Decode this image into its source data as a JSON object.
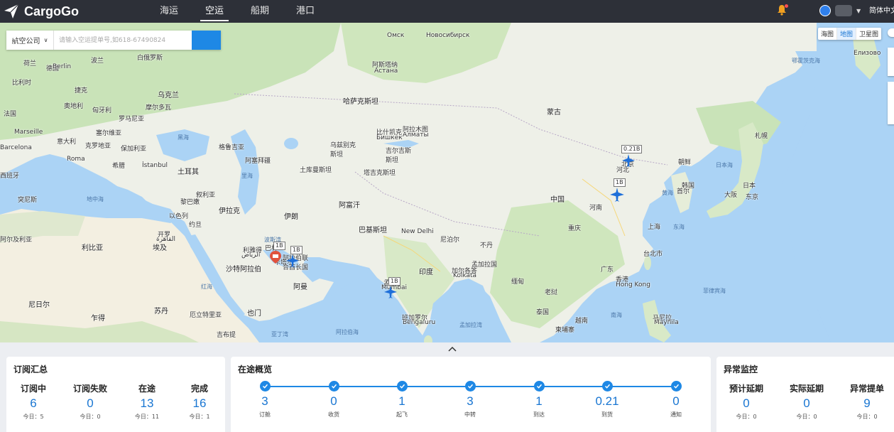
{
  "app": {
    "name": "CargoGo",
    "language": "简体中文"
  },
  "nav": {
    "items": [
      "海运",
      "空运",
      "船期",
      "港口"
    ],
    "active": "空运"
  },
  "search": {
    "select_label": "航空公司",
    "placeholder": "请输入空运提单号,如618-67490824"
  },
  "map_types": [
    "海图",
    "地图",
    "卫星图"
  ],
  "map_type_active": "地图",
  "map_labels": {
    "countries": [
      "蒙古",
      "中国",
      "印度",
      "伊朗",
      "阿富汗",
      "巴基斯坦",
      "哈萨克斯坦",
      "乌兹别克斯坦",
      "土库曼斯坦",
      "吉尔吉斯斯坦",
      "塔吉克斯坦",
      "土耳其",
      "伊拉克",
      "叙利亚",
      "约旦",
      "以色列",
      "黎巴嫩",
      "沙特阿拉伯",
      "阿曼",
      "也门",
      "埃及",
      "利比亚",
      "苏丹",
      "乍得",
      "尼日尔",
      "厄立特里亚",
      "吉布提",
      "阿塞拜疆",
      "格鲁吉亚",
      "希腊",
      "意大利",
      "西班牙",
      "法国",
      "德国",
      "波兰",
      "乌克兰",
      "白俄罗斯",
      "罗马尼亚",
      "塞尔维亚",
      "保加利亚",
      "匈牙利",
      "奥地利",
      "捷克",
      "荷兰",
      "比利时",
      "缅甸",
      "泰国",
      "老挝",
      "越南",
      "柬埔寨",
      "孟加拉国",
      "尼泊尔",
      "不丹",
      "朝鲜",
      "韩国",
      "日本",
      "突尼斯",
      "阿尔及利亚",
      "摩尔多瓦",
      "克罗地亚",
      "巴林",
      "阿拉伯联合酋长国",
      "卡塔尔"
    ],
    "cities": [
      "Омск",
      "Новосибирск",
      "Астана",
      "Алматы",
      "Бишкек",
      "Berlin",
      "Marseille",
      "Barcelona",
      "Roma",
      "İstanbul",
      "New Delhi",
      "Mumbai",
      "Bengaluru",
      "Kolkata",
      "Hong Kong",
      "Maynila",
      "Елизово",
      "الرياض",
      "القاهرة",
      "大阪",
      "东京",
      "札幌",
      "台北市",
      "上海",
      "北京",
      "河北",
      "河南",
      "重庆",
      "广东",
      "香港",
      "阿斯塔纳",
      "比什凯克",
      "阿拉木图",
      "开罗",
      "利雅得",
      "孟买",
      "班加罗尔",
      "加尔各答",
      "马尼拉",
      "首尔"
    ],
    "seas": [
      "黑海",
      "地中海",
      "里海",
      "红海",
      "阿拉伯海",
      "孟加拉湾",
      "南海",
      "菲律宾海",
      "东海",
      "黄海",
      "日本海",
      "鄂霍茨克海",
      "亚丁湾",
      "波斯湾"
    ]
  },
  "map_pins": [
    {
      "label": "0.21B"
    },
    {
      "label": "1B"
    },
    {
      "label": "1B"
    },
    {
      "label": "1B"
    },
    {
      "label": "1B"
    }
  ],
  "panels": {
    "subscription": {
      "title": "订阅汇总",
      "stats": [
        {
          "label": "订阅中",
          "value": "6",
          "today": "今日：5"
        },
        {
          "label": "订阅失败",
          "value": "0",
          "today": "今日：0"
        },
        {
          "label": "在途",
          "value": "13",
          "today": "今日：11"
        },
        {
          "label": "完成",
          "value": "16",
          "today": "今日：1"
        }
      ]
    },
    "transit": {
      "title": "在途概览",
      "steps": [
        {
          "value": "3",
          "label": "订舱"
        },
        {
          "value": "0",
          "label": "收货"
        },
        {
          "value": "1",
          "label": "起飞"
        },
        {
          "value": "3",
          "label": "中转"
        },
        {
          "value": "1",
          "label": "到达"
        },
        {
          "value": "0.21",
          "label": "到货"
        },
        {
          "value": "0",
          "label": "通知"
        }
      ]
    },
    "anomaly": {
      "title": "异常监控",
      "stats": [
        {
          "label": "预计延期",
          "value": "0",
          "today": "今日：0"
        },
        {
          "label": "实际延期",
          "value": "0",
          "today": "今日：0"
        },
        {
          "label": "异常提单",
          "value": "9",
          "today": "今日：0"
        }
      ]
    }
  },
  "colors": {
    "accent": "#1e88e5",
    "topbar": "#2d3038",
    "water": "#abd3f5",
    "land": "#eef0e8"
  }
}
